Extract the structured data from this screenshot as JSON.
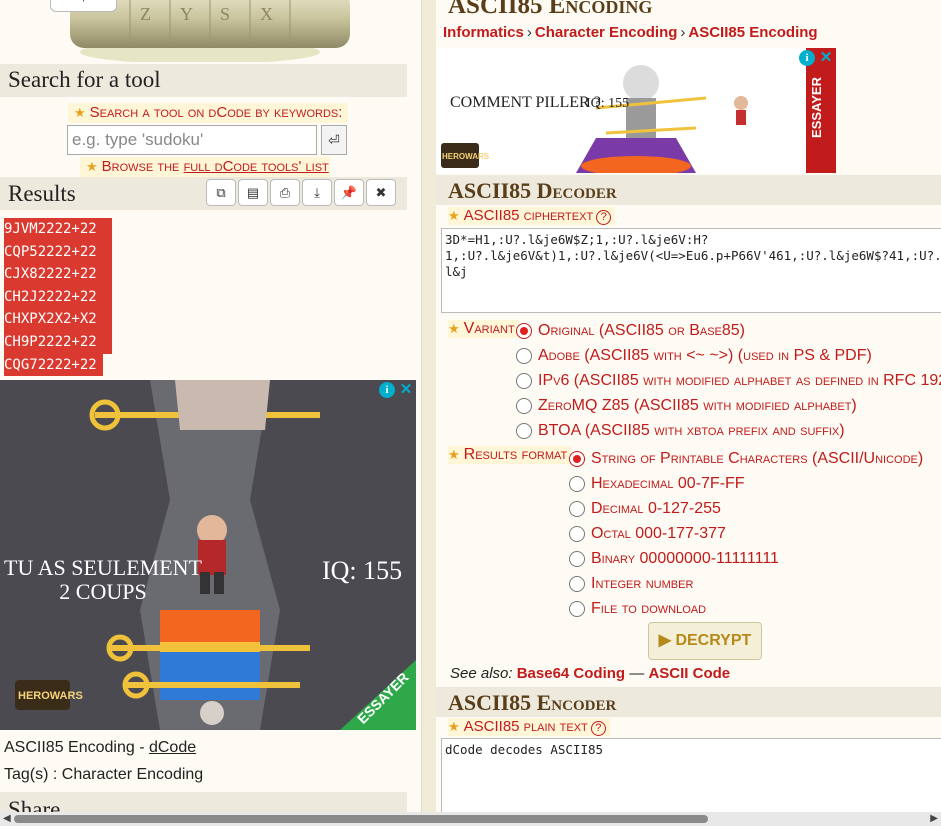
{
  "left": {
    "search_heading": "Search for a tool",
    "search_label": "Search a tool on dCode by keywords:",
    "search_placeholder": "e.g. type 'sudoku'",
    "enter_symbol": "⏎",
    "browse_prefix": "Browse the ",
    "browse_link": "full dCode tools' list",
    "results_heading": "Results",
    "result_lines": [
      "9JVM2222+22",
      "CQP52222+22",
      "CJX82222+22",
      "CH2J2222+22",
      "CHXPX2X2+X2",
      "CH9P2222+22",
      "CQG72222+22"
    ],
    "result_buttons": [
      "⧉",
      "▤",
      "⎙",
      "⤓",
      "📌",
      "✖"
    ],
    "ad_text_left": "TU AS SEULEMENT\n2 COUPS",
    "ad_text_right": "IQ: 155",
    "ad_brand": "HEROWARS",
    "ad_banner": "ESSAYER",
    "page_title_prefix": "ASCII85 Encoding - ",
    "page_title_link": "dCode",
    "tags": "Tag(s) : Character Encoding",
    "share_heading": "Share"
  },
  "right": {
    "title": "ASCII85 Encoding",
    "breadcrumbs": [
      "Informatics",
      "Character Encoding",
      "ASCII85 Encoding"
    ],
    "top_ad": {
      "text": "COMMENT PILLER ?",
      "iq": "IQ: 155",
      "banner": "ESSAYER",
      "brand": "HEROWARS"
    },
    "decoder": {
      "heading": "ASCII85 Decoder",
      "ciphertext_label": "ASCII85 ciphertext",
      "ciphertext": "3D*=H1,:U?.l&je6W$Z;1,:U?.l&je6V:H?\n1,:U?.l&je6V&t)1,:U?.l&je6V(<U=>Eu6.p+P66V'461,:U?.l&je6W$?41,:U?.l&j",
      "variant_label": "Variant",
      "variants": [
        {
          "text": "Original (ASCII85 or Base85)",
          "checked": true
        },
        {
          "text": "Adobe (ASCII85 with <~ ~>) (used in PS & PDF)",
          "checked": false
        },
        {
          "text": "IPv6 (ASCII85 with modified alphabet as defined in RFC 192",
          "checked": false
        },
        {
          "text": "ZeroMQ Z85 (ASCII85 with modified alphabet)",
          "checked": false
        },
        {
          "text": "BTOA (ASCII85 with xbtoa prefix and suffix)",
          "checked": false
        }
      ],
      "format_label": "Results format",
      "formats": [
        {
          "text": "String of Printable Characters (ASCII/Unicode)",
          "checked": true
        },
        {
          "text": "Hexadecimal 00-7F-FF",
          "checked": false
        },
        {
          "text": "Decimal 0-127-255",
          "checked": false
        },
        {
          "text": "Octal 000-177-377",
          "checked": false
        },
        {
          "text": "Binary 00000000-11111111",
          "checked": false
        },
        {
          "text": "Integer number",
          "checked": false
        },
        {
          "text": "File to download",
          "checked": false
        }
      ],
      "button": "▶ DECRYPT",
      "see_also_label": "See also:",
      "see_also_1": "Base64 Coding",
      "see_also_sep": " — ",
      "see_also_2": "ASCII Code"
    },
    "encoder": {
      "heading": "ASCII85 Encoder",
      "plaintext_label": "ASCII85 plain text",
      "plaintext": "dCode decodes ASCII85"
    }
  },
  "help_symbol": "?",
  "ad_info": "i",
  "ad_close": "✕",
  "scroll_left": "◀",
  "scroll_right": "▶"
}
